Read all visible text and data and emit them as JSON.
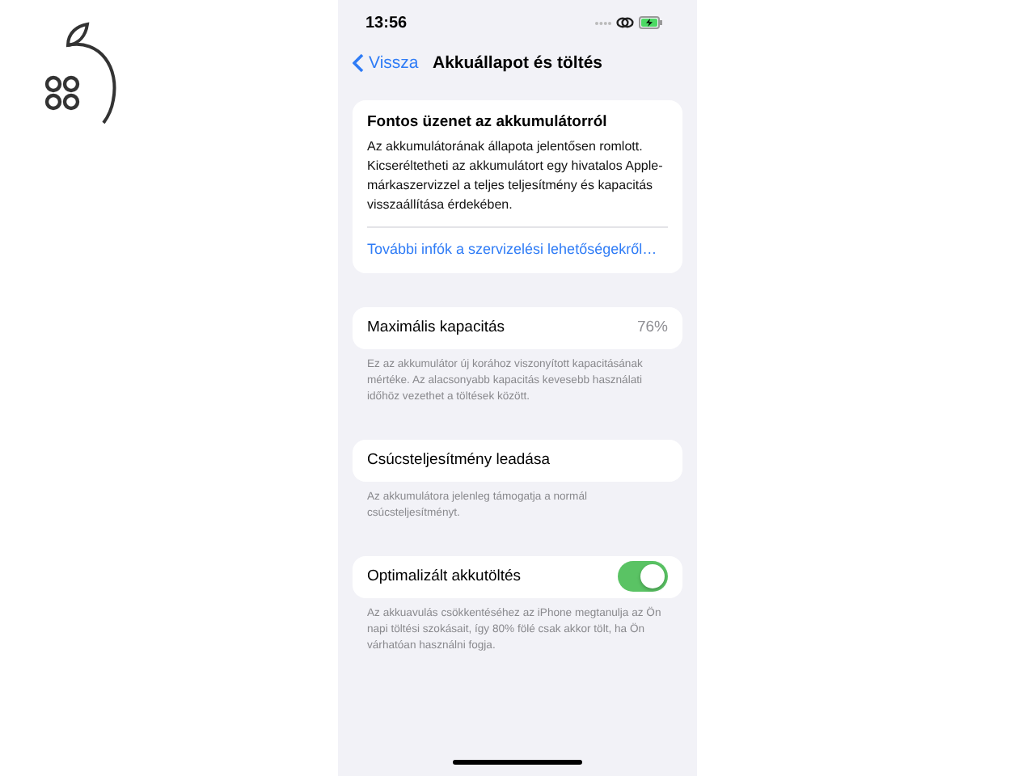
{
  "status_bar": {
    "time": "13:56"
  },
  "nav": {
    "back": "Vissza",
    "title": "Akkuállapot és töltés"
  },
  "message_card": {
    "title": "Fontos üzenet az akkumulátorról",
    "body": "Az akkumulátorának állapota jelentősen romlott. Kicseréltetheti az akkumulátort egy hivatalos Apple-márkaszervizzel a teljes teljesítmény és kapacitás visszaállítása érdekében.",
    "link": "További infók a szervizelési lehetőségekről…"
  },
  "sections": [
    {
      "kind": "value",
      "label": "Maximális kapacitás",
      "value": "76%",
      "footer": "Ez az akkumulátor új korához viszonyított kapacitásának mértéke. Az alacsonyabb kapacitás kevesebb használati időhöz vezethet a töltések között."
    },
    {
      "kind": "plain",
      "label": "Csúcsteljesítmény leadása",
      "footer": "Az akkumulátora jelenleg támogatja a normál csúcsteljesítményt."
    },
    {
      "kind": "toggle",
      "label": "Optimalizált akkutöltés",
      "on": true,
      "footer": "Az akkuavulás csökkentéséhez az iPhone megtanulja az Ön napi töltési szokásait, így 80% fölé csak akkor tölt, ha Ön várhatóan használni fogja."
    }
  ]
}
